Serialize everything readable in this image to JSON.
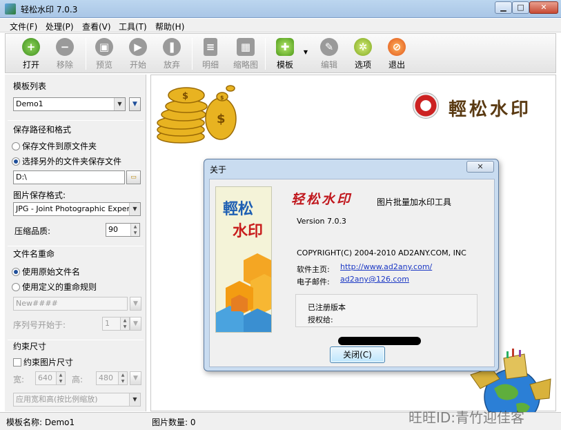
{
  "window": {
    "title": "轻松水印 7.0.3",
    "controls": {
      "minimize": "▁",
      "maximize": "□",
      "close": "✕"
    }
  },
  "menu": [
    "文件(F)",
    "处理(P)",
    "查看(V)",
    "工具(T)",
    "帮助(H)"
  ],
  "toolbar": {
    "open": "打开",
    "remove": "移除",
    "preview": "预览",
    "start": "开始",
    "abort": "放弃",
    "details": "明细",
    "thumbnails": "缩略图",
    "template": "模板",
    "edit": "编辑",
    "options": "选项",
    "exit": "退出"
  },
  "left": {
    "template_section": "模板列表",
    "template_value": "Demo1",
    "save_section": "保存路径和格式",
    "save_to_original": "保存文件到原文件夹",
    "save_to_other": "选择另外的文件夹保存文件",
    "path_value": "D:\\",
    "format_label": "图片保存格式:",
    "format_value": "JPG - Joint Photographic Experts (",
    "quality_label": "压缩品质:",
    "quality_value": "90",
    "rename_section": "文件名重命",
    "use_original_name": "使用原始文件名",
    "use_custom_rule": "使用定义的重命规则",
    "rule_value": "New####",
    "seq_label": "序列号开始于:",
    "seq_value": "1",
    "constrain_section": "约束尺寸",
    "constrain_check": "约束图片尺寸",
    "width_label": "宽:",
    "width_value": "640",
    "height_label": "高:",
    "height_value": "480",
    "scale_mode": "应用宽和高(按比例缩放)"
  },
  "canvas": {
    "brand": "輕松水印"
  },
  "dialog": {
    "title": "关于",
    "close_x": "✕",
    "splash_line1": "輕松",
    "splash_line2": "水印",
    "brand_script": "轻松水印",
    "subtitle": "图片批量加水印工具",
    "version": "Version   7.0.3",
    "copyright": "COPYRIGHT(C) 2004-2010 AD2ANY.COM, INC",
    "homepage_label": "软件主页:",
    "homepage_url": "http://www.ad2any.com/",
    "email_label": "电子邮件:",
    "email": "ad2any@126.com",
    "registered": "已注册版本",
    "licensed_to": "授权给:",
    "close_button": "关闭(C)"
  },
  "status": {
    "template_name": "模板名称: Demo1",
    "image_count": "图片数量:  0"
  },
  "watermark": "旺旺ID:青竹迎佳客"
}
